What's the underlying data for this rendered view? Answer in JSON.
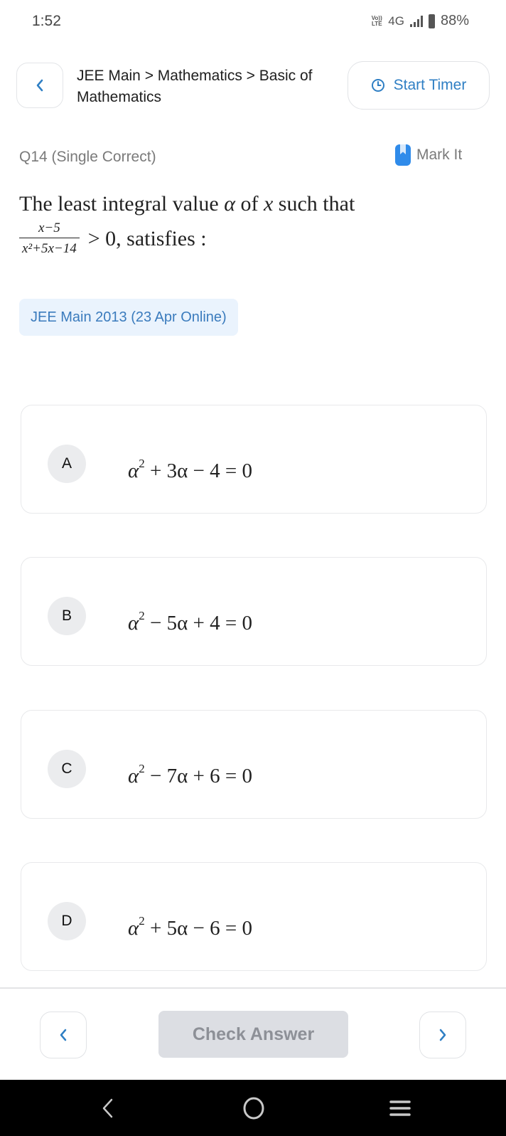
{
  "status_bar": {
    "time": "1:52",
    "volte_top": "Vo))",
    "volte_bottom": "LTE",
    "network": "4G",
    "battery": "88%"
  },
  "header": {
    "breadcrumb": "JEE Main > Mathematics > Basic of Mathematics",
    "timer_label": "Start Timer",
    "icons": {
      "back": "chevron-left",
      "timer": "clock"
    }
  },
  "question": {
    "meta": "Q14 (Single Correct)",
    "mark_label": "Mark It",
    "text_line1_prefix": "The least integral value ",
    "alpha": "α",
    "text_line1_mid": " of ",
    "x": "x",
    "text_line1_suffix": " such that",
    "fraction_numerator": "x−5",
    "fraction_denominator": "x²+5x−14",
    "text_line2_suffix": " > 0, satisfies :",
    "source": "JEE Main 2013 (23 Apr Online)"
  },
  "options": [
    {
      "label": "A",
      "base": "α",
      "exp": "2",
      "rest": " + 3α − 4 = 0"
    },
    {
      "label": "B",
      "base": "α",
      "exp": "2",
      "rest": " − 5α + 4 = 0"
    },
    {
      "label": "C",
      "base": "α",
      "exp": "2",
      "rest": " − 7α + 6 = 0"
    },
    {
      "label": "D",
      "base": "α",
      "exp": "2",
      "rest": " + 5α − 6 = 0"
    }
  ],
  "footer": {
    "check_answer_label": "Check Answer",
    "icons": {
      "prev": "chevron-left",
      "next": "chevron-right"
    }
  },
  "system_nav": {
    "icons": [
      "back",
      "home",
      "recents"
    ]
  },
  "colors": {
    "accent": "#2f7fc4",
    "bookmark": "#2f8bea",
    "source_bg": "#eaf3fd",
    "disabled_button": "#dcdee3"
  }
}
